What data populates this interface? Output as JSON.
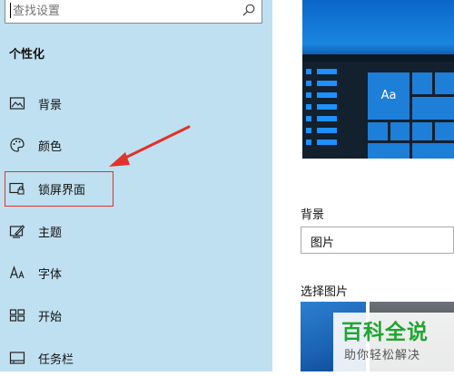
{
  "search": {
    "placeholder": "查找设置"
  },
  "sidebar": {
    "section_title": "个性化",
    "items": [
      {
        "label": "背景",
        "icon": "image-icon"
      },
      {
        "label": "颜色",
        "icon": "palette-icon"
      },
      {
        "label": "锁屏界面",
        "icon": "lock-screen-icon"
      },
      {
        "label": "主题",
        "icon": "theme-icon"
      },
      {
        "label": "字体",
        "icon": "font-icon"
      },
      {
        "label": "开始",
        "icon": "start-icon"
      },
      {
        "label": "任务栏",
        "icon": "taskbar-icon"
      }
    ]
  },
  "main": {
    "preview_tile_label": "Aa",
    "background_label": "背景",
    "background_select_value": "图片",
    "choose_picture_label": "选择图片"
  },
  "watermark": {
    "title": "百科全说",
    "subtitle": "助你轻松解决"
  },
  "colors": {
    "sidebar_bg": "#bfe0f0",
    "accent": "#1e7fd8",
    "highlight": "#e2322a",
    "watermark_green": "#1fa62f"
  }
}
